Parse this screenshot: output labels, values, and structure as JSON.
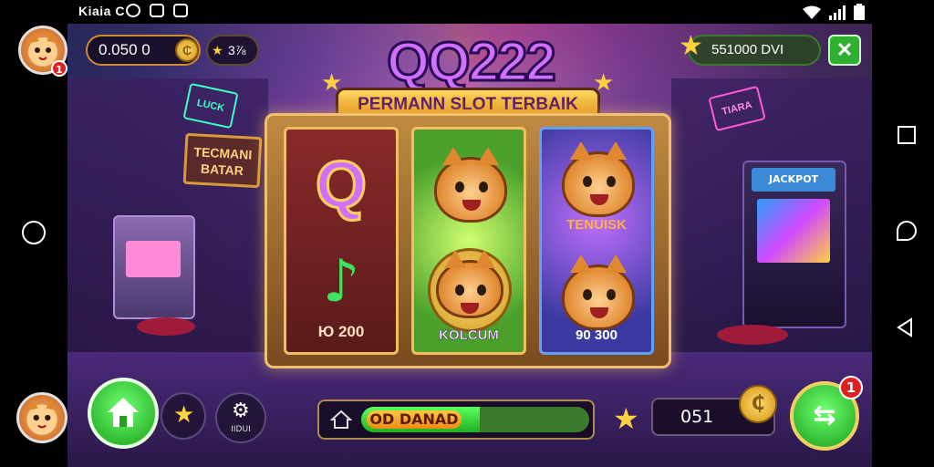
{
  "status_bar": {
    "left_text": "Kiaia C",
    "icons": [
      "messenger-icon",
      "image-icon",
      "notification-icon"
    ],
    "right_icons": [
      "wifi-icon",
      "signal-icon",
      "battery-icon"
    ]
  },
  "nav": {
    "left": [
      "home-circle-icon"
    ],
    "right": [
      "recents-square-icon",
      "assistant-icon",
      "back-triangle-icon"
    ]
  },
  "header": {
    "balance": "0.050 0",
    "coin_symbol": "₵",
    "star_count": "3⅞",
    "top_right_value": "551000 DVI",
    "close_label": "✕"
  },
  "logo": {
    "title": "QQ222",
    "subtitle": "PERMANN SLOT TERBAIK"
  },
  "signs": {
    "left_sign": "TECMANI BATAR",
    "neon_green": "LUCK",
    "neon_pink": "TIARA",
    "arcade_right_top": "JACKPOT"
  },
  "reels": [
    {
      "symbol_top": "Q",
      "symbol_bottom": "♪",
      "label": "Ю 200"
    },
    {
      "label": "KOLCUM"
    },
    {
      "label_top": "TENUISK",
      "label": "90 300"
    }
  ],
  "footer": {
    "progress_label": "OD DANAD",
    "progress_fraction": 0.52,
    "counter": "051",
    "spin_badge": "1",
    "settings_caption": "IIDUI"
  },
  "colors": {
    "accent_green": "#18a018",
    "gold": "#ffd040",
    "logo_purple": "#d070ff"
  }
}
